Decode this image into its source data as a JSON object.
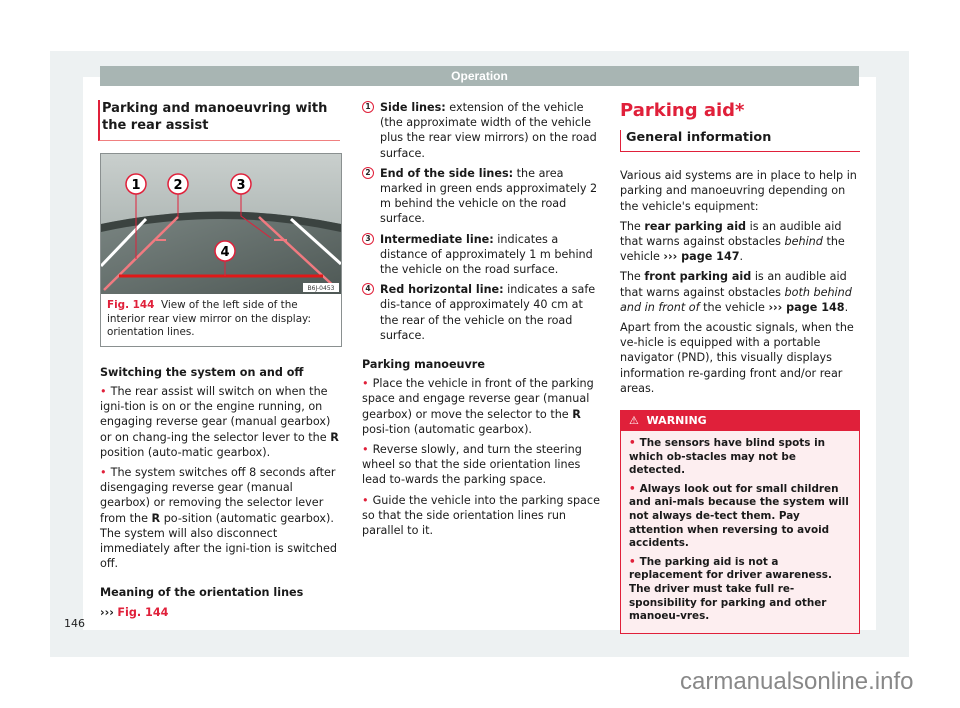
{
  "header": {
    "section": "Operation"
  },
  "left_column": {
    "title": "Parking and manoeuvring with the rear assist",
    "figure": {
      "callouts": [
        "1",
        "2",
        "3",
        "4"
      ],
      "code": "B6J-0453",
      "caption_ref": "Fig. 144",
      "caption_text": "View of the left side of the interior rear view mirror on the display: orientation lines."
    },
    "switching_heading": "Switching the system on and off",
    "switching_bullets": [
      {
        "before": "The rear assist will switch on when the igni-tion is on or the engine running, on engaging reverse gear (manual gearbox) or on chang-ing the selector lever to the ",
        "bold": "R",
        "after": " position (auto-matic gearbox)."
      },
      {
        "before": "The system switches off 8 seconds after disengaging reverse gear (manual gearbox) or removing the selector lever from the ",
        "bold": "R",
        "after": " po-sition (automatic gearbox). The system will also disconnect immediately after the igni-tion is switched off."
      }
    ],
    "meaning_heading": "Meaning of the orientation lines",
    "meaning_ref_arrows": "›››",
    "meaning_ref": "Fig. 144"
  },
  "middle_column": {
    "items": [
      {
        "num": "1",
        "term": "Side lines:",
        "text": " extension of the vehicle (the approximate width of the vehicle plus the rear view mirrors) on the road surface."
      },
      {
        "num": "2",
        "term": "End of the side lines:",
        "text": " the area marked in green ends approximately 2 m behind the vehicle on the road surface."
      },
      {
        "num": "3",
        "term": "Intermediate line:",
        "text": " indicates a distance of approximately 1 m behind the vehicle on the road surface."
      },
      {
        "num": "4",
        "term": "Red horizontal line:",
        "text": " indicates a safe dis-tance of approximately 40 cm at the rear of the vehicle on the road surface."
      }
    ],
    "manoeuvre_heading": "Parking manoeuvre",
    "manoeuvre_bullets": [
      {
        "before": "Place the vehicle in front of the parking space and engage reverse gear (manual gearbox) or move the selector to the ",
        "bold": "R",
        "after": " posi-tion (automatic gearbox)."
      },
      {
        "before": "Reverse slowly, and turn the steering wheel so that the side orientation lines lead to-wards the parking space.",
        "bold": "",
        "after": ""
      },
      {
        "before": "Guide the vehicle into the parking space so that the side orientation lines run parallel to it.",
        "bold": "",
        "after": ""
      }
    ]
  },
  "right_column": {
    "title": "Parking aid*",
    "subtitle": "General information",
    "intro": "Various aid systems are in place to help in parking and manoeuvring depending on the vehicle's equipment:",
    "rear": {
      "pre": "The ",
      "bold": "rear parking aid",
      "mid": " is an audible aid that warns against obstacles ",
      "italic": "behind",
      "post": " the vehicle ",
      "ref": "››› page 147",
      "end": "."
    },
    "front": {
      "pre": "The ",
      "bold": "front parking aid",
      "mid": " is an audible aid that warns against obstacles ",
      "italic": "both behind and in front of",
      "post": " the vehicle ",
      "ref": "››› page 148",
      "end": "."
    },
    "acoustic": "Apart from the acoustic signals, when the ve-hicle is equipped with a portable navigator (PND), this visually displays information re-garding front and/or rear areas.",
    "warning": {
      "icon": "warning-triangle-icon",
      "label": "WARNING",
      "bullets": [
        "The sensors have blind spots in which ob-stacles may not be detected.",
        "Always look out for small children and ani-mals because the system will not always de-tect them. Pay attention when reversing to avoid accidents.",
        "The parking aid is not a replacement for driver awareness. The driver must take full re-sponsibility for parking and other manoeu-vres."
      ]
    }
  },
  "footer": {
    "page_number": "146",
    "watermark": "carmanualsonline.info"
  },
  "colors": {
    "accent": "#e0203a",
    "header_bar": "#a8b5b3",
    "frame": "#edf1f2",
    "warning_bg": "#fdeef0"
  }
}
